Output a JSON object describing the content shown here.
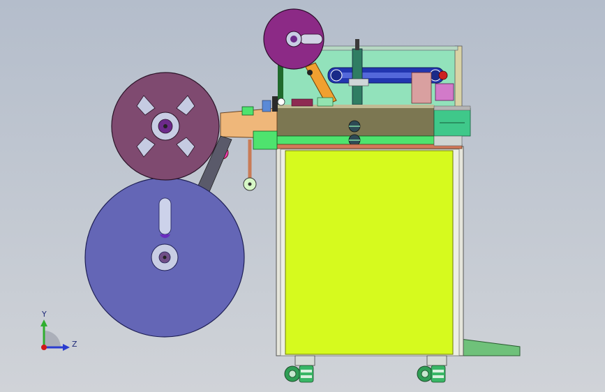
{
  "viewport": {
    "background_top": "#b4bdcb",
    "background_bottom": "#d0d3d8"
  },
  "triad": {
    "y_label": "Y",
    "z_label": "Z",
    "y_axis_color": "#2fae2f",
    "z_axis_color": "#2a3ccf",
    "origin_color": "#d01818"
  },
  "colors": {
    "cabinet_body": "#d6fa1e",
    "cabinet_frame": "#e6e6dc",
    "top_mechanism_panel": "#92e2bb",
    "upper_reel": "#8c2a86",
    "left_reel": "#7f4a70",
    "lower_reel": "#6466b6",
    "hub": "#c8cde4",
    "conveyor_belt": "#2236b0",
    "blade_housing": "#7c7752",
    "feed_plate": "#efb77a",
    "casters": "#2f9e55",
    "foot_ramp": "#6fc17a"
  },
  "icons": {
    "triad": "coordinate-triad-icon",
    "caster": "caster-wheel-icon"
  }
}
